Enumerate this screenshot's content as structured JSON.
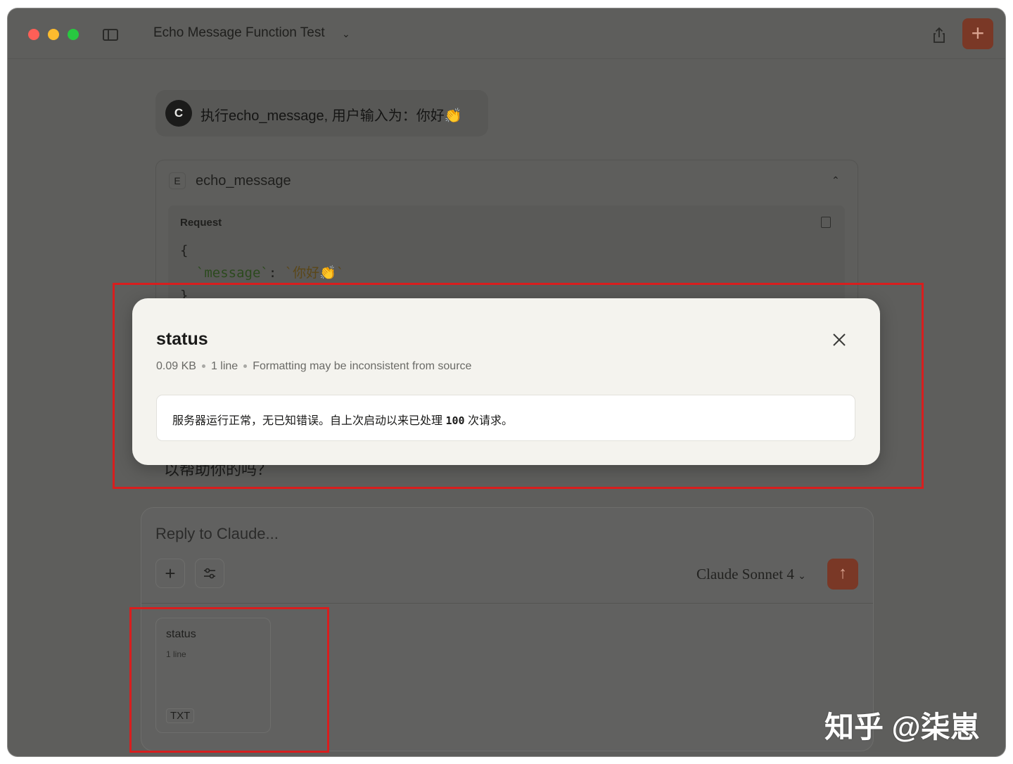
{
  "titlebar": {
    "conversation_title": "Echo Message Function Test",
    "title_chevron": "⌄",
    "new_chat_label": "+"
  },
  "user_message": {
    "avatar_initial": "C",
    "text": "执行echo_message, 用户输入为：你好👏"
  },
  "tool_call": {
    "letter": "E",
    "name": "echo_message",
    "collapse_icon": "⌃",
    "request_label": "Request",
    "code_open": "{",
    "code_key": "`message`",
    "code_colon": ": ",
    "code_value": "`你好👏`",
    "code_close": "}"
  },
  "partial_response_text": "以帮助你的吗？",
  "composer": {
    "placeholder": "Reply to Claude...",
    "add_label": "+",
    "model": "Claude Sonnet 4",
    "model_chevron": "⌄",
    "send_label": "↑"
  },
  "attachment": {
    "name": "status",
    "lines": "1 line",
    "type": "TXT"
  },
  "modal": {
    "title": "status",
    "size": "0.09 KB",
    "lines": "1 line",
    "note": "Formatting may be inconsistent from source",
    "content_prefix": "服务器运行正常，无已知错误。自上次启动以来已处理 ",
    "content_number": "100",
    "content_suffix": " 次请求。"
  },
  "watermark": "知乎 @柒崽",
  "colors": {
    "accent": "#7a3826",
    "highlight": "#d81e1e",
    "modal_bg": "#f4f3ee"
  }
}
